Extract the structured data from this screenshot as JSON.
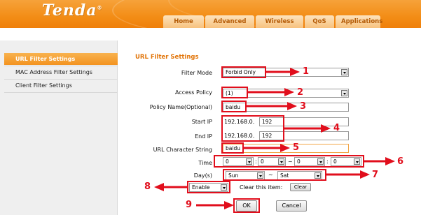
{
  "header": {
    "logo": "Tenda",
    "logo_mark": "®",
    "nav": [
      "Home",
      "Advanced",
      "Wireless",
      "QoS",
      "Applications"
    ]
  },
  "sidebar": {
    "items": [
      {
        "label": "URL Filter Settings",
        "active": true
      },
      {
        "label": "MAC Address Filter Settings",
        "active": false
      },
      {
        "label": "Client Filter Settings",
        "active": false
      }
    ]
  },
  "main": {
    "title": "URL Filter Settings",
    "filter_mode": {
      "label": "Filter Mode",
      "value": "Forbid Only"
    },
    "access_policy": {
      "label": "Access Policy",
      "value": "(1)"
    },
    "policy_name": {
      "label": "Policy Name(Optional)",
      "value": "baidu"
    },
    "start_ip": {
      "label": "Start IP",
      "prefix": "192.168.0.",
      "value": "192"
    },
    "end_ip": {
      "label": "End IP",
      "prefix": "192.168.0.",
      "value": "192"
    },
    "url_string": {
      "label": "URL Character String",
      "value": "baidu"
    },
    "time": {
      "label": "Time",
      "h1": "0",
      "m1": "0",
      "sep": "~",
      "h2": "0",
      "m2": "0"
    },
    "days": {
      "label": "Day(s)",
      "from": "Sun",
      "sep": "~",
      "to": "Sat"
    },
    "enable": {
      "value": "Enable"
    },
    "clear_item": {
      "label": "Clear this item:",
      "button": "Clear"
    },
    "ok_button": "OK",
    "cancel_button": "Cancel"
  },
  "annotations": {
    "n1": "1",
    "n2": "2",
    "n3": "3",
    "n4": "4",
    "n5": "5",
    "n6": "6",
    "n7": "7",
    "n8": "8",
    "n9": "9",
    "color": "#e10e1c"
  },
  "colors": {
    "header_orange": "#f38d16",
    "sidebar_active": "#f39320",
    "title_orange": "#e2760b"
  }
}
